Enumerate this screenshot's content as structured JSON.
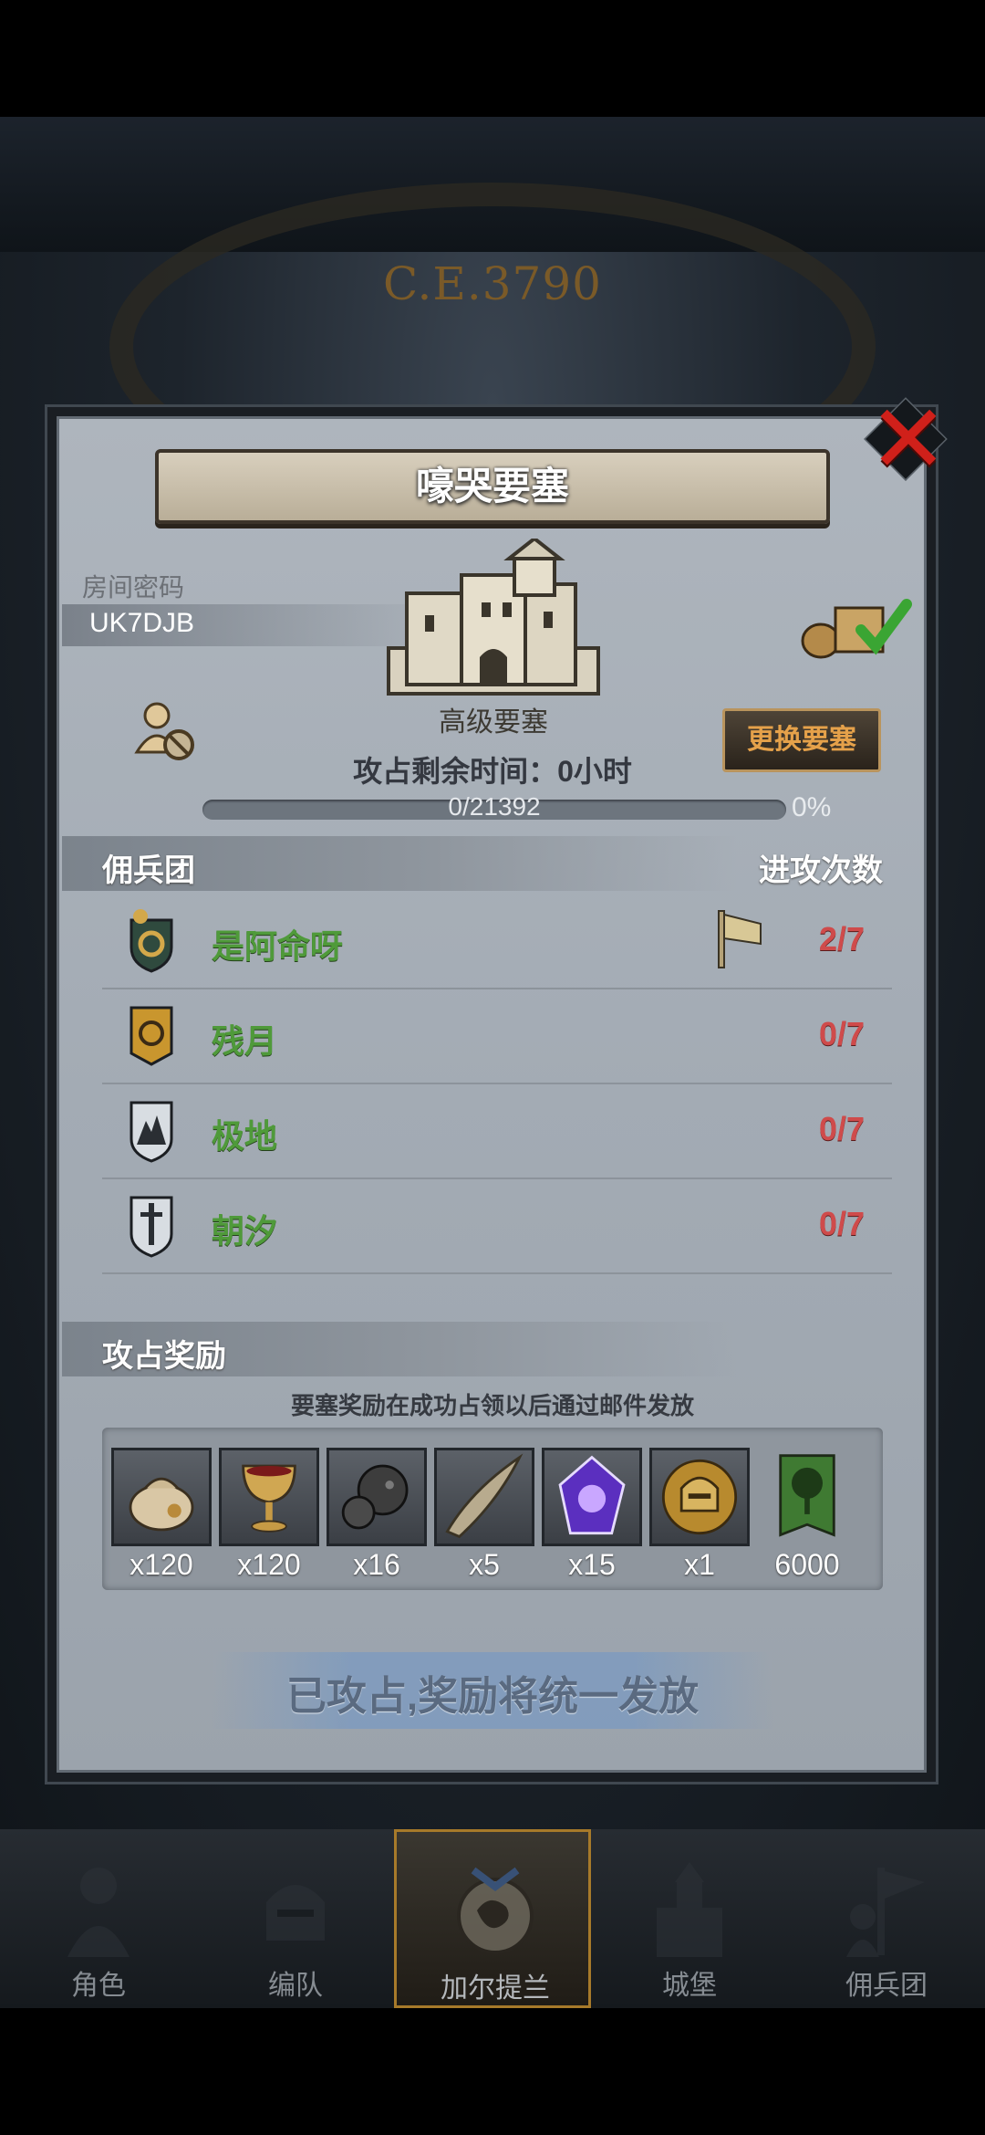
{
  "background": {
    "era_label": "C.E.3790"
  },
  "dialog": {
    "title": "嚎哭要塞",
    "room_label": "房间密码",
    "room_code": "UK7DJB",
    "fortress_type": "高级要塞",
    "time_remaining": "攻占剩余时间：0小时",
    "change_button": "更换要塞",
    "progress": {
      "text": "0/21392",
      "percent_label": "0%",
      "fraction": 0
    },
    "mercenary_section": {
      "title": "佣兵团",
      "attacks_header": "进攻次数",
      "rows": [
        {
          "name": "是阿命呀",
          "count": "2/7",
          "icon": "green-gold-shield-icon",
          "flag": true
        },
        {
          "name": "残月",
          "count": "0/7",
          "icon": "gold-moon-shield-icon",
          "flag": false
        },
        {
          "name": "极地",
          "count": "0/7",
          "icon": "mountain-shield-icon",
          "flag": false
        },
        {
          "name": "朝汐",
          "count": "0/7",
          "icon": "sword-shield-icon",
          "flag": false
        }
      ]
    },
    "reward_section": {
      "title": "攻占奖励",
      "note": "要塞奖励在成功占领以后通过邮件发放",
      "items": [
        {
          "icon": "money-bag-icon",
          "count": "x120"
        },
        {
          "icon": "chalice-icon",
          "count": "x120"
        },
        {
          "icon": "ore-rock-icon",
          "count": "x16"
        },
        {
          "icon": "horn-icon",
          "count": "x5"
        },
        {
          "icon": "purple-crystal-icon",
          "count": "x15"
        },
        {
          "icon": "knight-helmet-medal-icon",
          "count": "x1"
        },
        {
          "icon": "tree-banner-icon",
          "count": "6000"
        }
      ]
    },
    "status_button": "已攻占,奖励将统一发放"
  },
  "nav": {
    "active_index": 2,
    "items": [
      {
        "label": "角色",
        "icon": "knight-icon"
      },
      {
        "label": "编队",
        "icon": "helmet-icon"
      },
      {
        "label": "加尔提兰",
        "icon": "world-map-icon"
      },
      {
        "label": "城堡",
        "icon": "castle-icon"
      },
      {
        "label": "佣兵团",
        "icon": "mercenary-icon"
      }
    ]
  },
  "colors": {
    "accent_gold": "#e5a14a",
    "mercenary_name": "#4f9a3a",
    "attack_count": "#cf4b4b",
    "close_red": "#d0201a"
  }
}
